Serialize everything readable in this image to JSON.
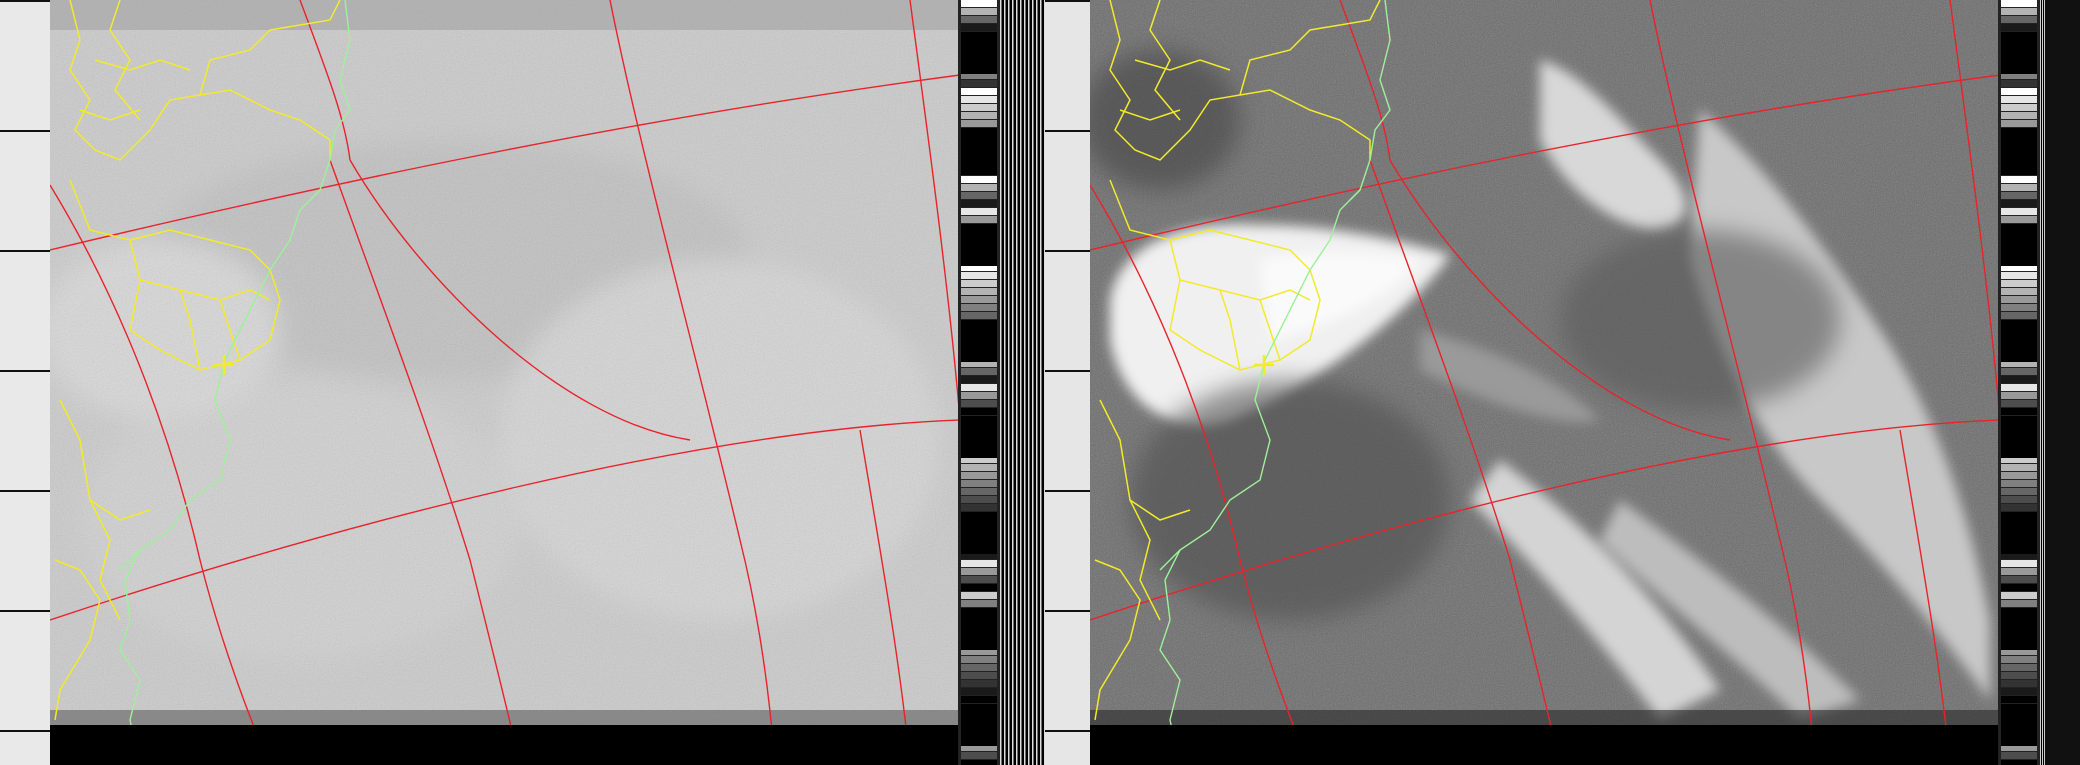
{
  "image": {
    "kind": "NOAA APT weather satellite image decode",
    "channels": [
      {
        "id": "A",
        "tone": "visible",
        "background": "#c9c9c9"
      },
      {
        "id": "B",
        "tone": "infrared",
        "background": "#6e6e6e"
      }
    ]
  },
  "overlay": {
    "graticule_color": "#e8232b",
    "borders_color": "#f2ea2a",
    "coastline_color": "#9ef09a",
    "marker_color": "#f2ea2a",
    "marker_icon": "plus-marker-icon"
  },
  "telemetry": {
    "wedge_colors": [
      "#ffffff",
      "#e6e6e6",
      "#cccccc",
      "#b3b3b3",
      "#999999",
      "#808080",
      "#666666",
      "#4d4d4d",
      "#333333",
      "#1a1a1a",
      "#000000"
    ]
  }
}
